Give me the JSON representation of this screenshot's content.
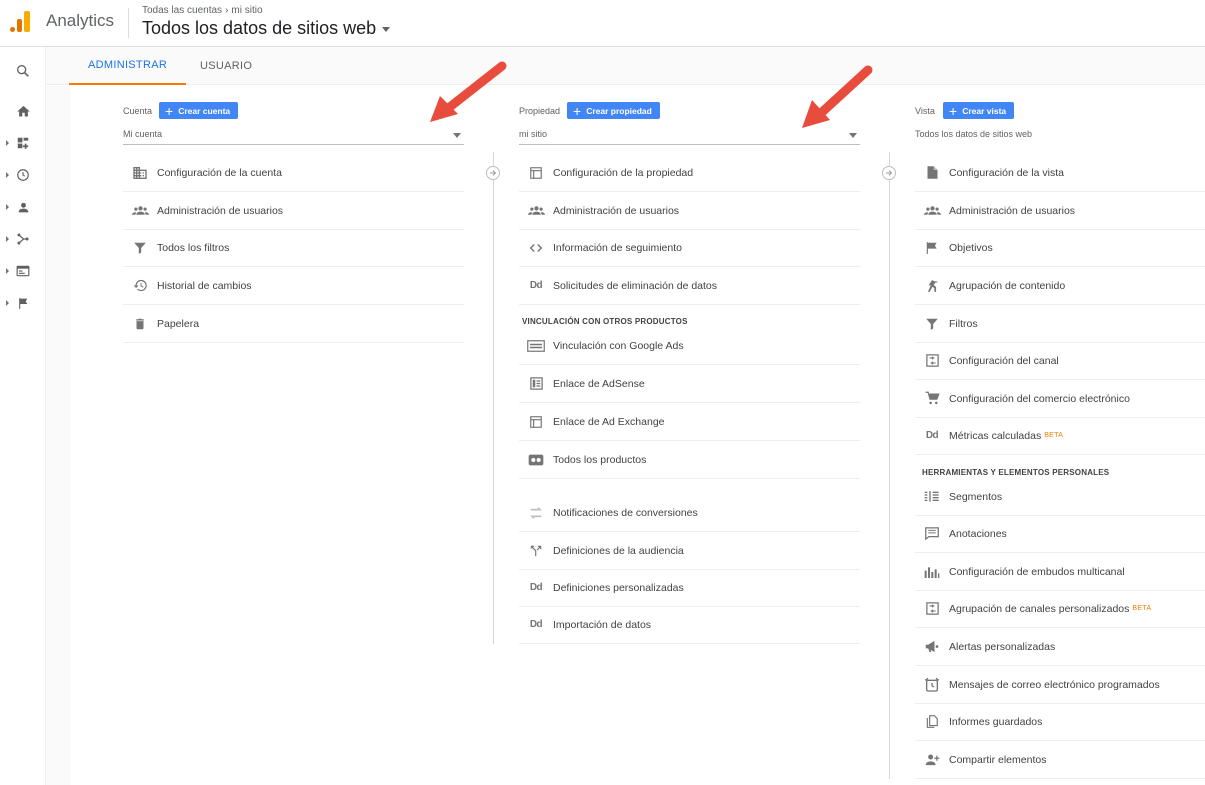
{
  "header": {
    "app_name": "Analytics",
    "breadcrumb_parent": "Todas las cuentas",
    "breadcrumb_current": "mi sitio",
    "view_title": "Todos los datos de sitios web"
  },
  "tabs": [
    {
      "label": "ADMINISTRAR",
      "active": true
    },
    {
      "label": "USUARIO",
      "active": false
    }
  ],
  "colors": {
    "accent": "#1a73e8",
    "tab_underline": "#f57c00",
    "button": "#4285f4",
    "arrow": "#e74c3c",
    "beta": "#f57c00"
  },
  "account": {
    "label": "Cuenta",
    "create_label": "Crear cuenta",
    "selected": "Mi cuenta",
    "items": [
      {
        "label": "Configuración de la cuenta",
        "icon": "building-icon"
      },
      {
        "label": "Administración de usuarios",
        "icon": "people-icon"
      },
      {
        "label": "Todos los filtros",
        "icon": "filter-icon"
      },
      {
        "label": "Historial de cambios",
        "icon": "history-icon"
      },
      {
        "label": "Papelera",
        "icon": "trash-icon"
      }
    ]
  },
  "property": {
    "label": "Propiedad",
    "create_label": "Crear propiedad",
    "selected": "mi sitio",
    "items": [
      {
        "label": "Configuración de la propiedad",
        "icon": "window-icon"
      },
      {
        "label": "Administración de usuarios",
        "icon": "people-icon"
      },
      {
        "label": "Información de seguimiento",
        "icon": "code-icon"
      },
      {
        "label": "Solicitudes de eliminación de datos",
        "icon": "dd-icon"
      }
    ],
    "section_title": "VINCULACIÓN CON OTROS PRODUCTOS",
    "linking_items": [
      {
        "label": "Vinculación con Google Ads",
        "icon": "ads-icon"
      },
      {
        "label": "Enlace de AdSense",
        "icon": "adsense-icon"
      },
      {
        "label": "Enlace de Ad Exchange",
        "icon": "window-icon"
      },
      {
        "label": "Todos los productos",
        "icon": "products-icon"
      }
    ],
    "more_items": [
      {
        "label": "Notificaciones de conversiones",
        "icon": "swap-icon"
      },
      {
        "label": "Definiciones de la audiencia",
        "icon": "fork-icon"
      },
      {
        "label": "Definiciones personalizadas",
        "icon": "dd-icon"
      },
      {
        "label": "Importación de datos",
        "icon": "dd-icon"
      }
    ]
  },
  "view": {
    "label": "Vista",
    "create_label": "Crear vista",
    "selected": "Todos los datos de sitios web",
    "items": [
      {
        "label": "Configuración de la vista",
        "icon": "document-icon"
      },
      {
        "label": "Administración de usuarios",
        "icon": "people-icon"
      },
      {
        "label": "Objetivos",
        "icon": "flag-icon"
      },
      {
        "label": "Agrupación de contenido",
        "icon": "person-walk-icon"
      },
      {
        "label": "Filtros",
        "icon": "filter-icon"
      },
      {
        "label": "Configuración del canal",
        "icon": "channel-icon"
      },
      {
        "label": "Configuración del comercio electrónico",
        "icon": "cart-icon"
      },
      {
        "label": "Métricas calculadas",
        "icon": "dd-icon",
        "badge": "BETA"
      }
    ],
    "section_title": "HERRAMIENTAS Y ELEMENTOS PERSONALES",
    "tools_items": [
      {
        "label": "Segmentos",
        "icon": "segments-icon"
      },
      {
        "label": "Anotaciones",
        "icon": "comment-icon"
      },
      {
        "label": "Configuración de embudos multicanal",
        "icon": "bar-chart-icon"
      },
      {
        "label": "Agrupación de canales personalizados",
        "icon": "channel-icon",
        "badge": "BETA"
      },
      {
        "label": "Alertas personalizadas",
        "icon": "megaphone-icon"
      },
      {
        "label": "Mensajes de correo electrónico programados",
        "icon": "alarm-icon"
      },
      {
        "label": "Informes guardados",
        "icon": "copy-icon"
      },
      {
        "label": "Compartir elementos",
        "icon": "person-add-icon"
      }
    ]
  }
}
